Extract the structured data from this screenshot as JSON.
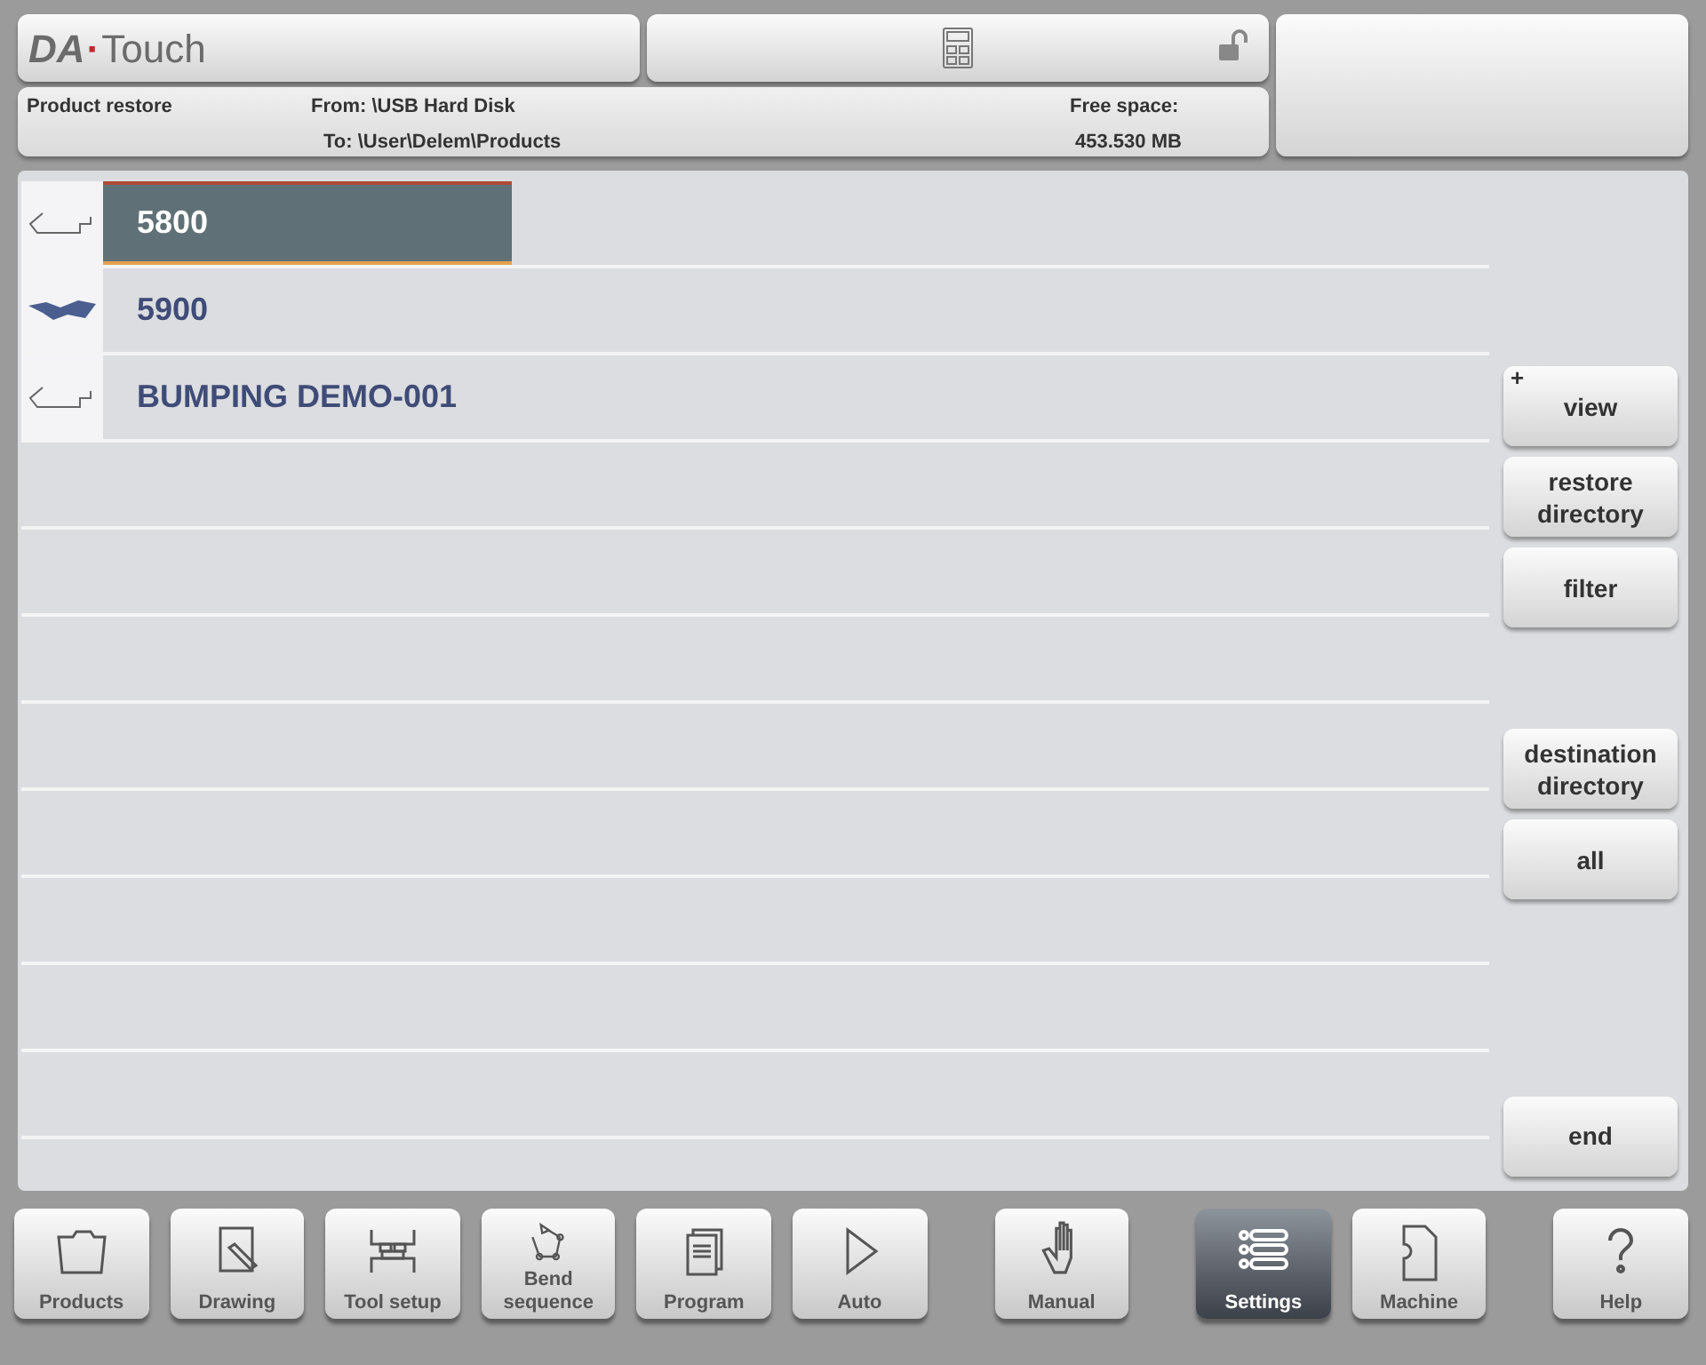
{
  "header": {
    "logo_bold": "DA",
    "logo_dot": "·",
    "logo_light": "Touch",
    "locked": false
  },
  "info_bar": {
    "title": "Product restore",
    "from": "From: \\USB Hard Disk",
    "to": "To: \\User\\Delem\\Products",
    "free_label": "Free space:",
    "free_value": "453.530 MB"
  },
  "products": [
    {
      "name": "5800",
      "kind": "outline",
      "selected": true
    },
    {
      "name": "5900",
      "kind": "solid",
      "selected": false
    },
    {
      "name": "BUMPING DEMO-001",
      "kind": "outline",
      "selected": false
    }
  ],
  "side_buttons": [
    {
      "label": "view",
      "marker": "+",
      "gap_before": false
    },
    {
      "label": "restore directory",
      "gap_before": false
    },
    {
      "label": "filter",
      "gap_before": false
    },
    {
      "label": "destination directory",
      "gap_before": true
    },
    {
      "label": "all",
      "gap_before": false
    }
  ],
  "end_button": {
    "label": "end"
  },
  "nav": [
    {
      "label": "Products",
      "kind": "folder",
      "selected": false,
      "gap_before": false
    },
    {
      "label": "Drawing",
      "kind": "drawing",
      "selected": false,
      "gap_before": false
    },
    {
      "label": "Tool setup",
      "kind": "tools",
      "selected": false,
      "gap_before": false
    },
    {
      "label": "Bend sequence",
      "kind": "bend",
      "selected": false,
      "gap_before": false
    },
    {
      "label": "Program",
      "kind": "program",
      "selected": false,
      "gap_before": false
    },
    {
      "label": "Auto",
      "kind": "auto",
      "selected": false,
      "gap_before": false
    },
    {
      "label": "Manual",
      "kind": "manual",
      "selected": false,
      "gap_before": true
    },
    {
      "label": "Settings",
      "kind": "settings",
      "selected": true,
      "gap_before": true
    },
    {
      "label": "Machine",
      "kind": "machine",
      "selected": false,
      "gap_before": false
    },
    {
      "label": "Help",
      "kind": "help",
      "selected": false,
      "gap_before": true
    }
  ]
}
